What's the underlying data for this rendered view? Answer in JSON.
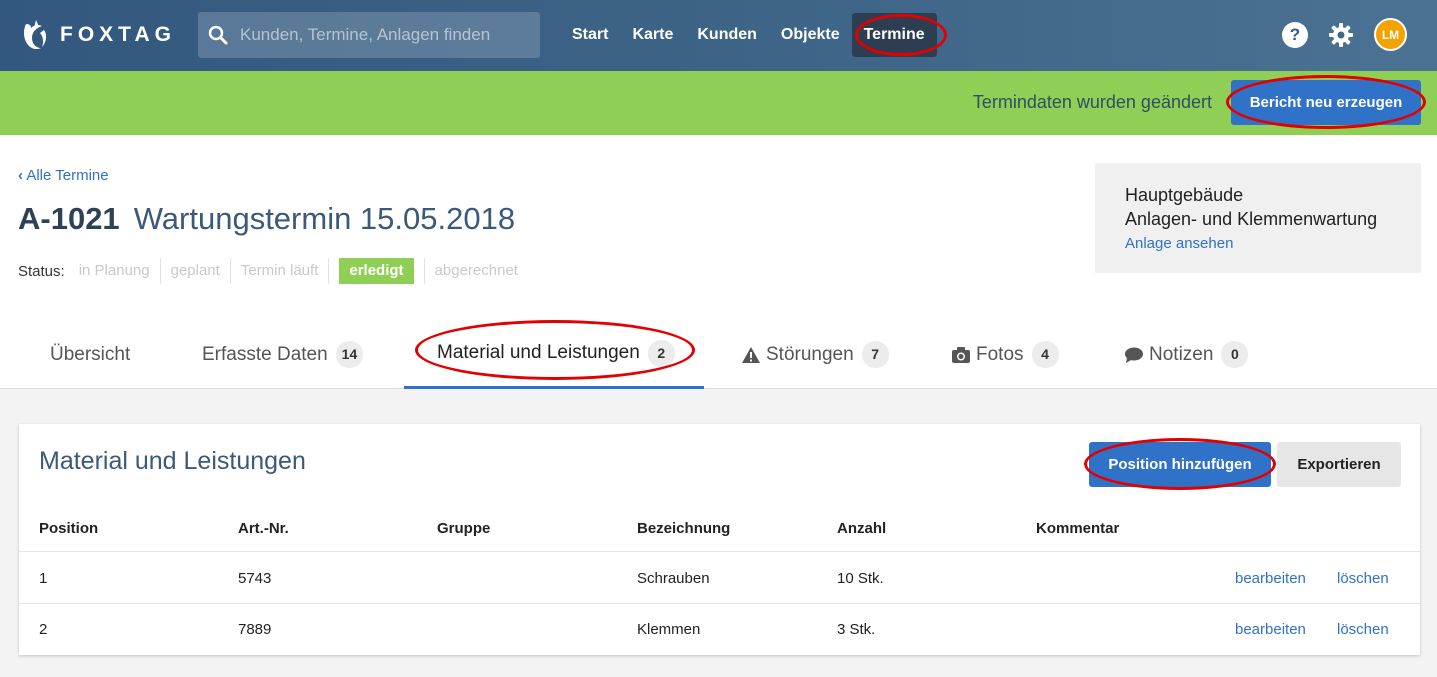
{
  "brand": {
    "name": "FOXTAG"
  },
  "search": {
    "placeholder": "Kunden, Termine, Anlagen finden"
  },
  "nav": {
    "items": [
      {
        "label": "Start"
      },
      {
        "label": "Karte"
      },
      {
        "label": "Kunden"
      },
      {
        "label": "Objekte"
      },
      {
        "label": "Termine",
        "active": true
      }
    ]
  },
  "user": {
    "initials": "LM"
  },
  "help_icon": "question-circle-icon",
  "settings_icon": "gear-icon",
  "notice": {
    "text": "Termindaten wurden geändert",
    "button": "Bericht neu erzeugen"
  },
  "back_link": "Alle Termine",
  "appointment": {
    "number": "A-1021",
    "title": "Wartungstermin 15.05.2018"
  },
  "status": {
    "label": "Status:",
    "steps": [
      "in Planung",
      "geplant",
      "Termin läuft",
      "erledigt",
      "abgerechnet"
    ],
    "active": "erledigt"
  },
  "info": {
    "building": "Hauptgebäude",
    "system": "Anlagen- und Klemmenwartung",
    "link": "Anlage ansehen"
  },
  "tabs": [
    {
      "label": "Übersicht"
    },
    {
      "label": "Erfasste Daten",
      "count": "14"
    },
    {
      "label": "Material und Leistungen",
      "count": "2",
      "active": true
    },
    {
      "label": "Störungen",
      "count": "7",
      "icon": "warning-icon"
    },
    {
      "label": "Fotos",
      "count": "4",
      "icon": "camera-icon"
    },
    {
      "label": "Notizen",
      "count": "0",
      "icon": "comment-icon"
    }
  ],
  "panel": {
    "title": "Material und Leistungen",
    "add_button": "Position hinzufügen",
    "export_button": "Exportieren",
    "columns": [
      "Position",
      "Art.-Nr.",
      "Gruppe",
      "Bezeichnung",
      "Anzahl",
      "Kommentar"
    ],
    "rows": [
      {
        "position": "1",
        "art_nr": "5743",
        "gruppe": "",
        "bezeichnung": "Schrauben",
        "anzahl": "10 Stk.",
        "kommentar": ""
      },
      {
        "position": "2",
        "art_nr": "7889",
        "gruppe": "",
        "bezeichnung": "Klemmen",
        "anzahl": "3 Stk.",
        "kommentar": ""
      }
    ],
    "edit_label": "bearbeiten",
    "delete_label": "löschen"
  },
  "colors": {
    "nav_bg": "#33587f",
    "notice_bg": "#8fcf55",
    "primary": "#2f72c7",
    "highlight_ring": "#e20000"
  }
}
